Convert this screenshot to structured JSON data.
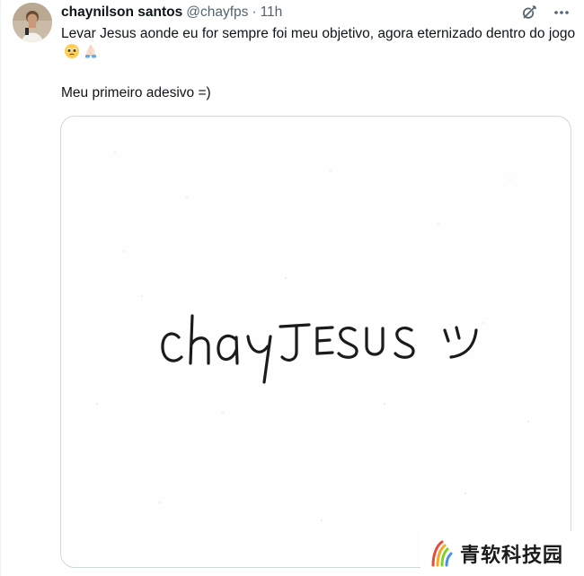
{
  "tweet": {
    "author": {
      "display_name": "chaynilson santos",
      "handle": "@chayfps",
      "separator": "·",
      "time": "11h"
    },
    "text_line1": "Levar Jesus aonde eu for sempre foi meu objetivo, agora eternizado dentro do jogo",
    "text_line1_emojis": [
      "pleading-face-emoji",
      "folded-hands-emoji"
    ],
    "text_line2": "Meu primeiro adesivo =)",
    "media": {
      "handwritten_text": "chayJESUS",
      "handwritten_smiley": "ツ"
    },
    "icons": {
      "grok": "grok-icon",
      "more": "more-icon"
    }
  },
  "watermark": {
    "text": "青软科技园",
    "logo": "watermark-logo-icon",
    "colors": [
      "#e94b3c",
      "#f5a623",
      "#7ed321",
      "#4a90e2"
    ]
  }
}
